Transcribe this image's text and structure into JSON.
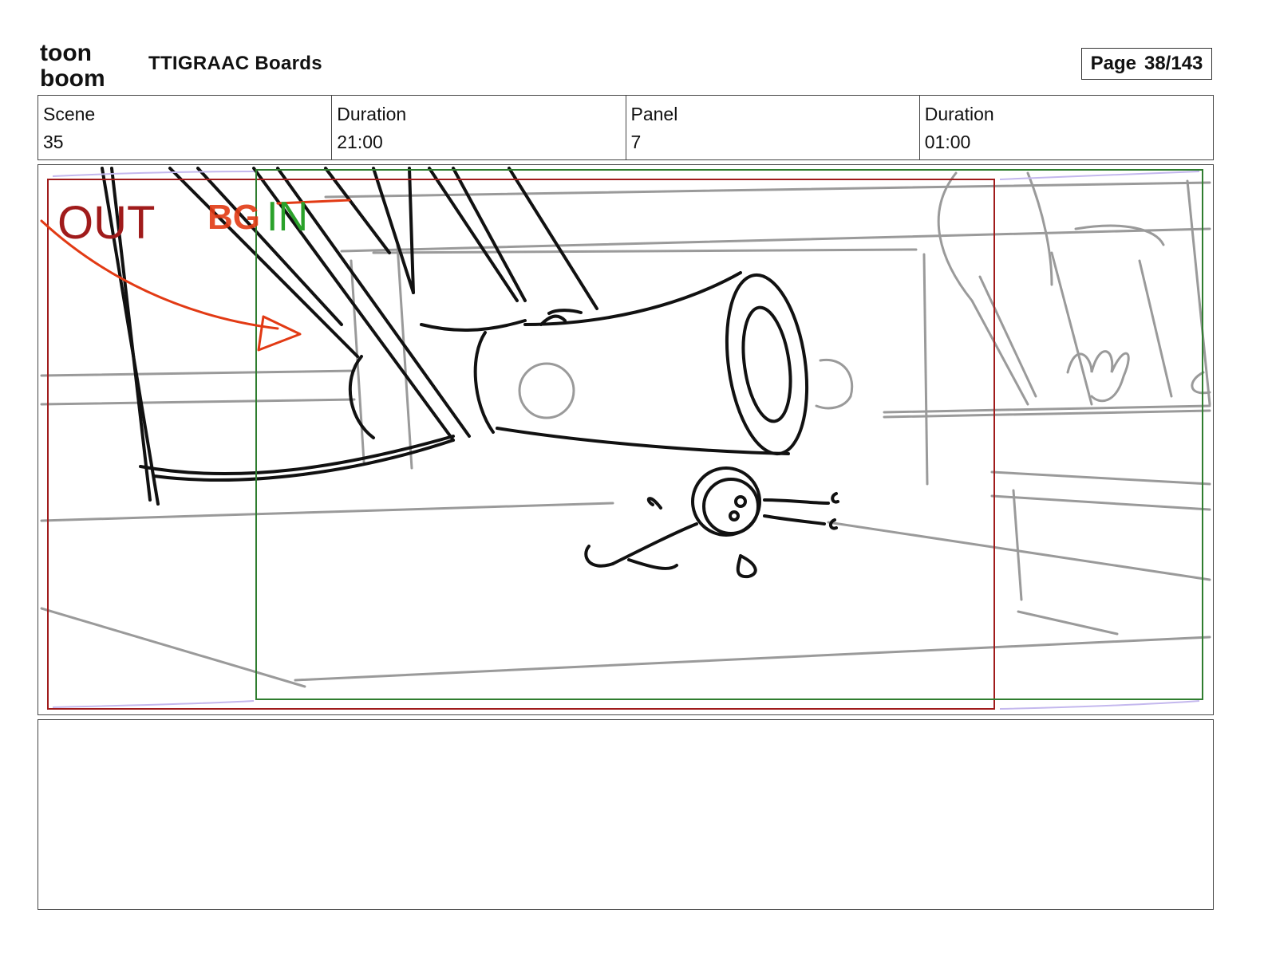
{
  "header": {
    "logo_top": "toon",
    "logo_bottom": "boom",
    "title": "TTIGRAAC Boards",
    "page_label": "Page",
    "page_value": "38/143"
  },
  "info": {
    "scene_label": "Scene",
    "scene_value": "35",
    "scene_duration_label": "Duration",
    "scene_duration_value": "21:00",
    "panel_label": "Panel",
    "panel_value": "7",
    "panel_duration_label": "Duration",
    "panel_duration_value": "01:00"
  },
  "panel": {
    "out_label": "OUT",
    "in_label": "IN",
    "scribble_label": "BG",
    "colors": {
      "out_frame": "#a01b1b",
      "in_frame": "#2f7d2f",
      "annotation": "#e23a14"
    }
  },
  "notes": {
    "text": ""
  }
}
